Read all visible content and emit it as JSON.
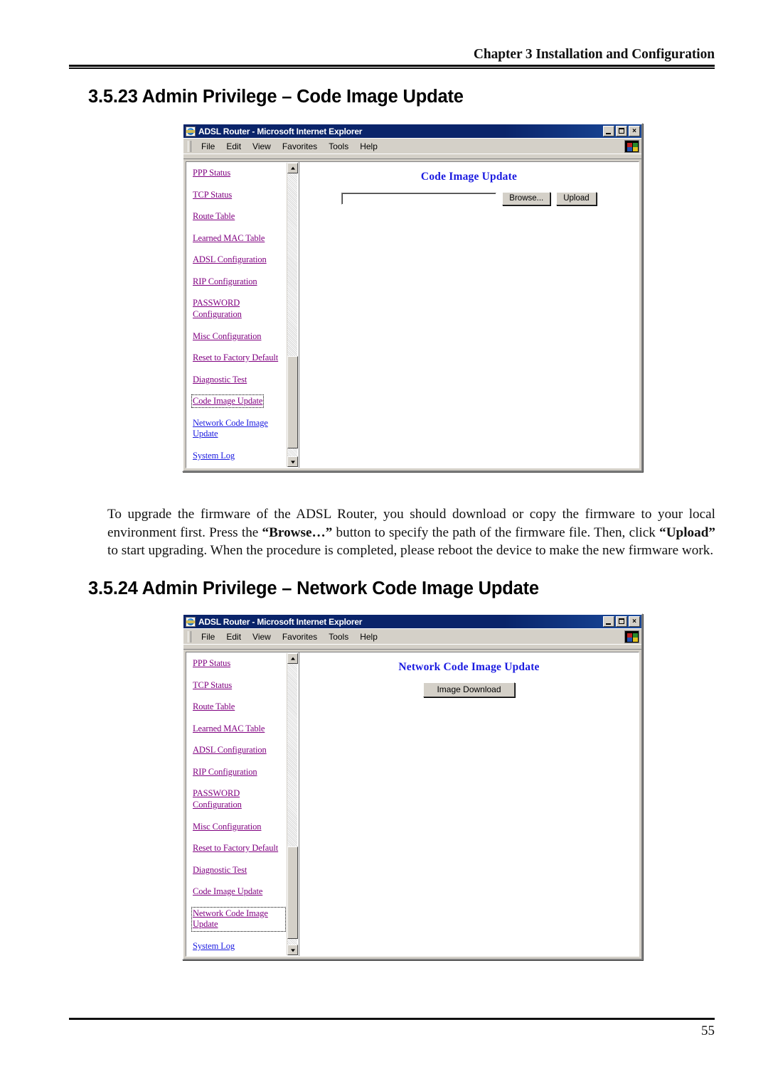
{
  "document": {
    "running_header": "Chapter 3 Installation and Configuration",
    "page_number": "55"
  },
  "sections": [
    {
      "heading": "3.5.23 Admin Privilege – Code Image Update"
    },
    {
      "heading": "3.5.24 Admin Privilege – Network Code Image Update"
    }
  ],
  "body_paragraph": {
    "part1": "To upgrade the firmware of the ADSL Router, you should download or copy the firmware to your local environment first. Press the ",
    "browse_bold": "“Browse…”",
    "part2": " button to specify the path of the firmware file. Then, click ",
    "upload_bold": "“Upload”",
    "part3": " to start upgrading. When the procedure is completed, please reboot the device to make the new firmware work."
  },
  "browser": {
    "title": "ADSL Router - Microsoft Internet Explorer",
    "menu": [
      "File",
      "Edit",
      "View",
      "Favorites",
      "Tools",
      "Help"
    ],
    "window_buttons": {
      "minimize": "minimize",
      "restore": "restore",
      "close": "×"
    }
  },
  "nav": {
    "items": [
      "PPP Status",
      "TCP Status",
      "Route Table",
      "Learned MAC Table",
      "ADSL Configuration",
      "RIP Configuration",
      "PASSWORD Configuration",
      "Misc Configuration",
      "Reset to Factory Default",
      "Diagnostic Test",
      "Code Image Update",
      "Network Code Image Update",
      "System Log"
    ]
  },
  "screen_code_image": {
    "page_title": "Code Image Update",
    "file_input_value": "",
    "file_input_placeholder": "",
    "browse_label": "Browse...",
    "upload_label": "Upload",
    "focused_nav_item": "Code Image Update"
  },
  "screen_network_code_image": {
    "page_title": "Network Code Image Update",
    "image_download_label": "Image Download",
    "focused_nav_item": "Network Code Image Update"
  },
  "colors": {
    "visited_link": "#800080",
    "unvisited_link": "#1a1ae0",
    "heading_blue": "#1a1ae0",
    "titlebar_blue": "#0a246a",
    "chrome_gray": "#d4d0c8"
  }
}
